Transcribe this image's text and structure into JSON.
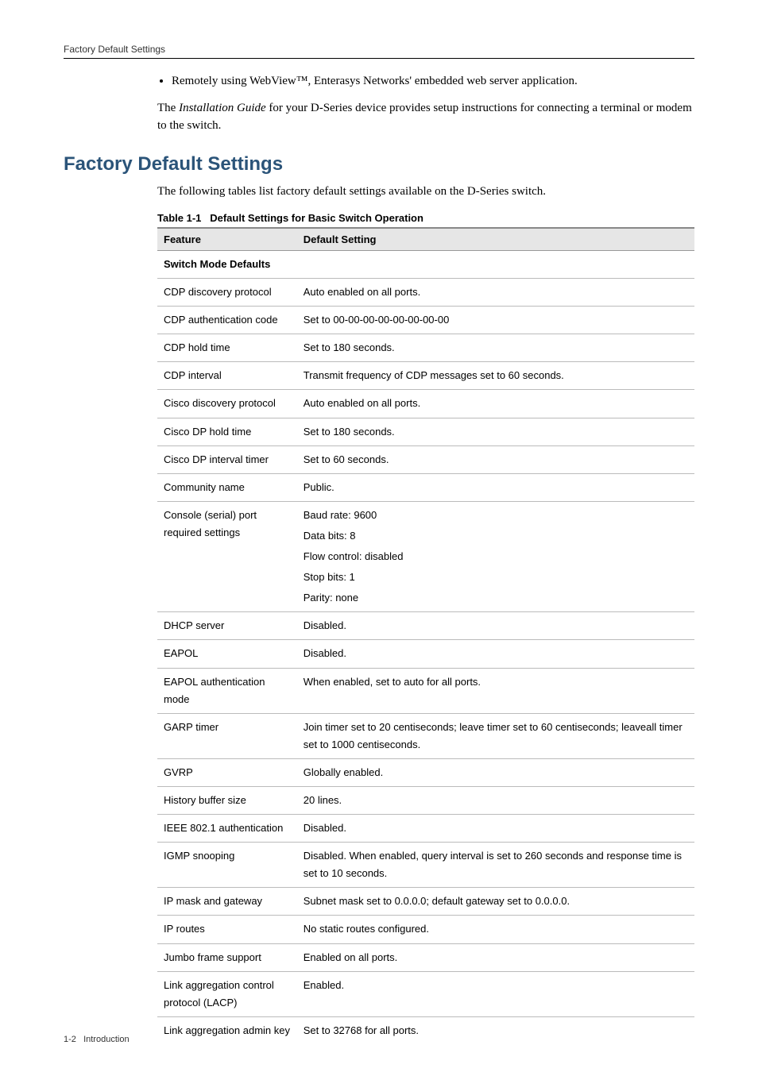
{
  "header": {
    "running_title": "Factory Default Settings"
  },
  "intro": {
    "bullet_prefix": "Remotely using WebView",
    "bullet_tm": "™",
    "bullet_suffix": ", Enterasys Networks' embedded web server application.",
    "para_prefix": "The ",
    "para_italic": "Installation Guide",
    "para_suffix": " for your D-Series device provides setup instructions for connecting a terminal or modem to the switch."
  },
  "section": {
    "heading": "Factory Default Settings",
    "lead": "The following tables list factory default settings available on the D-Series switch."
  },
  "table": {
    "caption_number": "Table 1-1",
    "caption_title": "Default Settings for Basic Switch Operation",
    "columns": {
      "feature": "Feature",
      "default": "Default Setting"
    },
    "subhead": "Switch Mode Defaults",
    "rows": [
      {
        "feature": "CDP discovery protocol",
        "value": "Auto enabled on all ports."
      },
      {
        "feature": "CDP authentication code",
        "value": "Set to 00-00-00-00-00-00-00-00"
      },
      {
        "feature": "CDP hold time",
        "value": "Set to 180 seconds."
      },
      {
        "feature": "CDP interval",
        "value": "Transmit frequency of CDP messages set to 60 seconds."
      },
      {
        "feature": "Cisco discovery protocol",
        "value": "Auto enabled on all ports."
      },
      {
        "feature": "Cisco DP hold time",
        "value": "Set to 180 seconds."
      },
      {
        "feature": "Cisco DP interval timer",
        "value": "Set to 60 seconds."
      },
      {
        "feature": "Community name",
        "value": "Public."
      },
      {
        "feature": "Console (serial) port required settings",
        "values": [
          "Baud rate: 9600",
          "Data bits: 8",
          "Flow control: disabled",
          "Stop bits: 1",
          "Parity: none"
        ]
      },
      {
        "feature": "DHCP server",
        "value": "Disabled."
      },
      {
        "feature": "EAPOL",
        "value": "Disabled."
      },
      {
        "feature": "EAPOL authentication mode",
        "value": "When enabled, set to auto for all ports."
      },
      {
        "feature": "GARP timer",
        "value": "Join timer set to 20 centiseconds; leave timer set to 60 centiseconds; leaveall timer set to 1000 centiseconds."
      },
      {
        "feature": "GVRP",
        "value": "Globally enabled."
      },
      {
        "feature": "History buffer size",
        "value": "20 lines."
      },
      {
        "feature": "IEEE 802.1 authentication",
        "value": "Disabled."
      },
      {
        "feature": "IGMP snooping",
        "value": "Disabled. When enabled, query interval is set to 260 seconds and response time is set to 10 seconds."
      },
      {
        "feature": "IP mask and gateway",
        "value": "Subnet mask set to 0.0.0.0; default gateway set to 0.0.0.0."
      },
      {
        "feature": "IP routes",
        "value": "No static routes configured."
      },
      {
        "feature": "Jumbo frame support",
        "value": "Enabled on all ports."
      },
      {
        "feature": "Link aggregation control protocol (LACP)",
        "value": "Enabled."
      },
      {
        "feature": "Link aggregation admin key",
        "value": "Set to 32768 for all ports."
      }
    ]
  },
  "footer": {
    "page_label": "1-2",
    "section_label": "Introduction"
  }
}
